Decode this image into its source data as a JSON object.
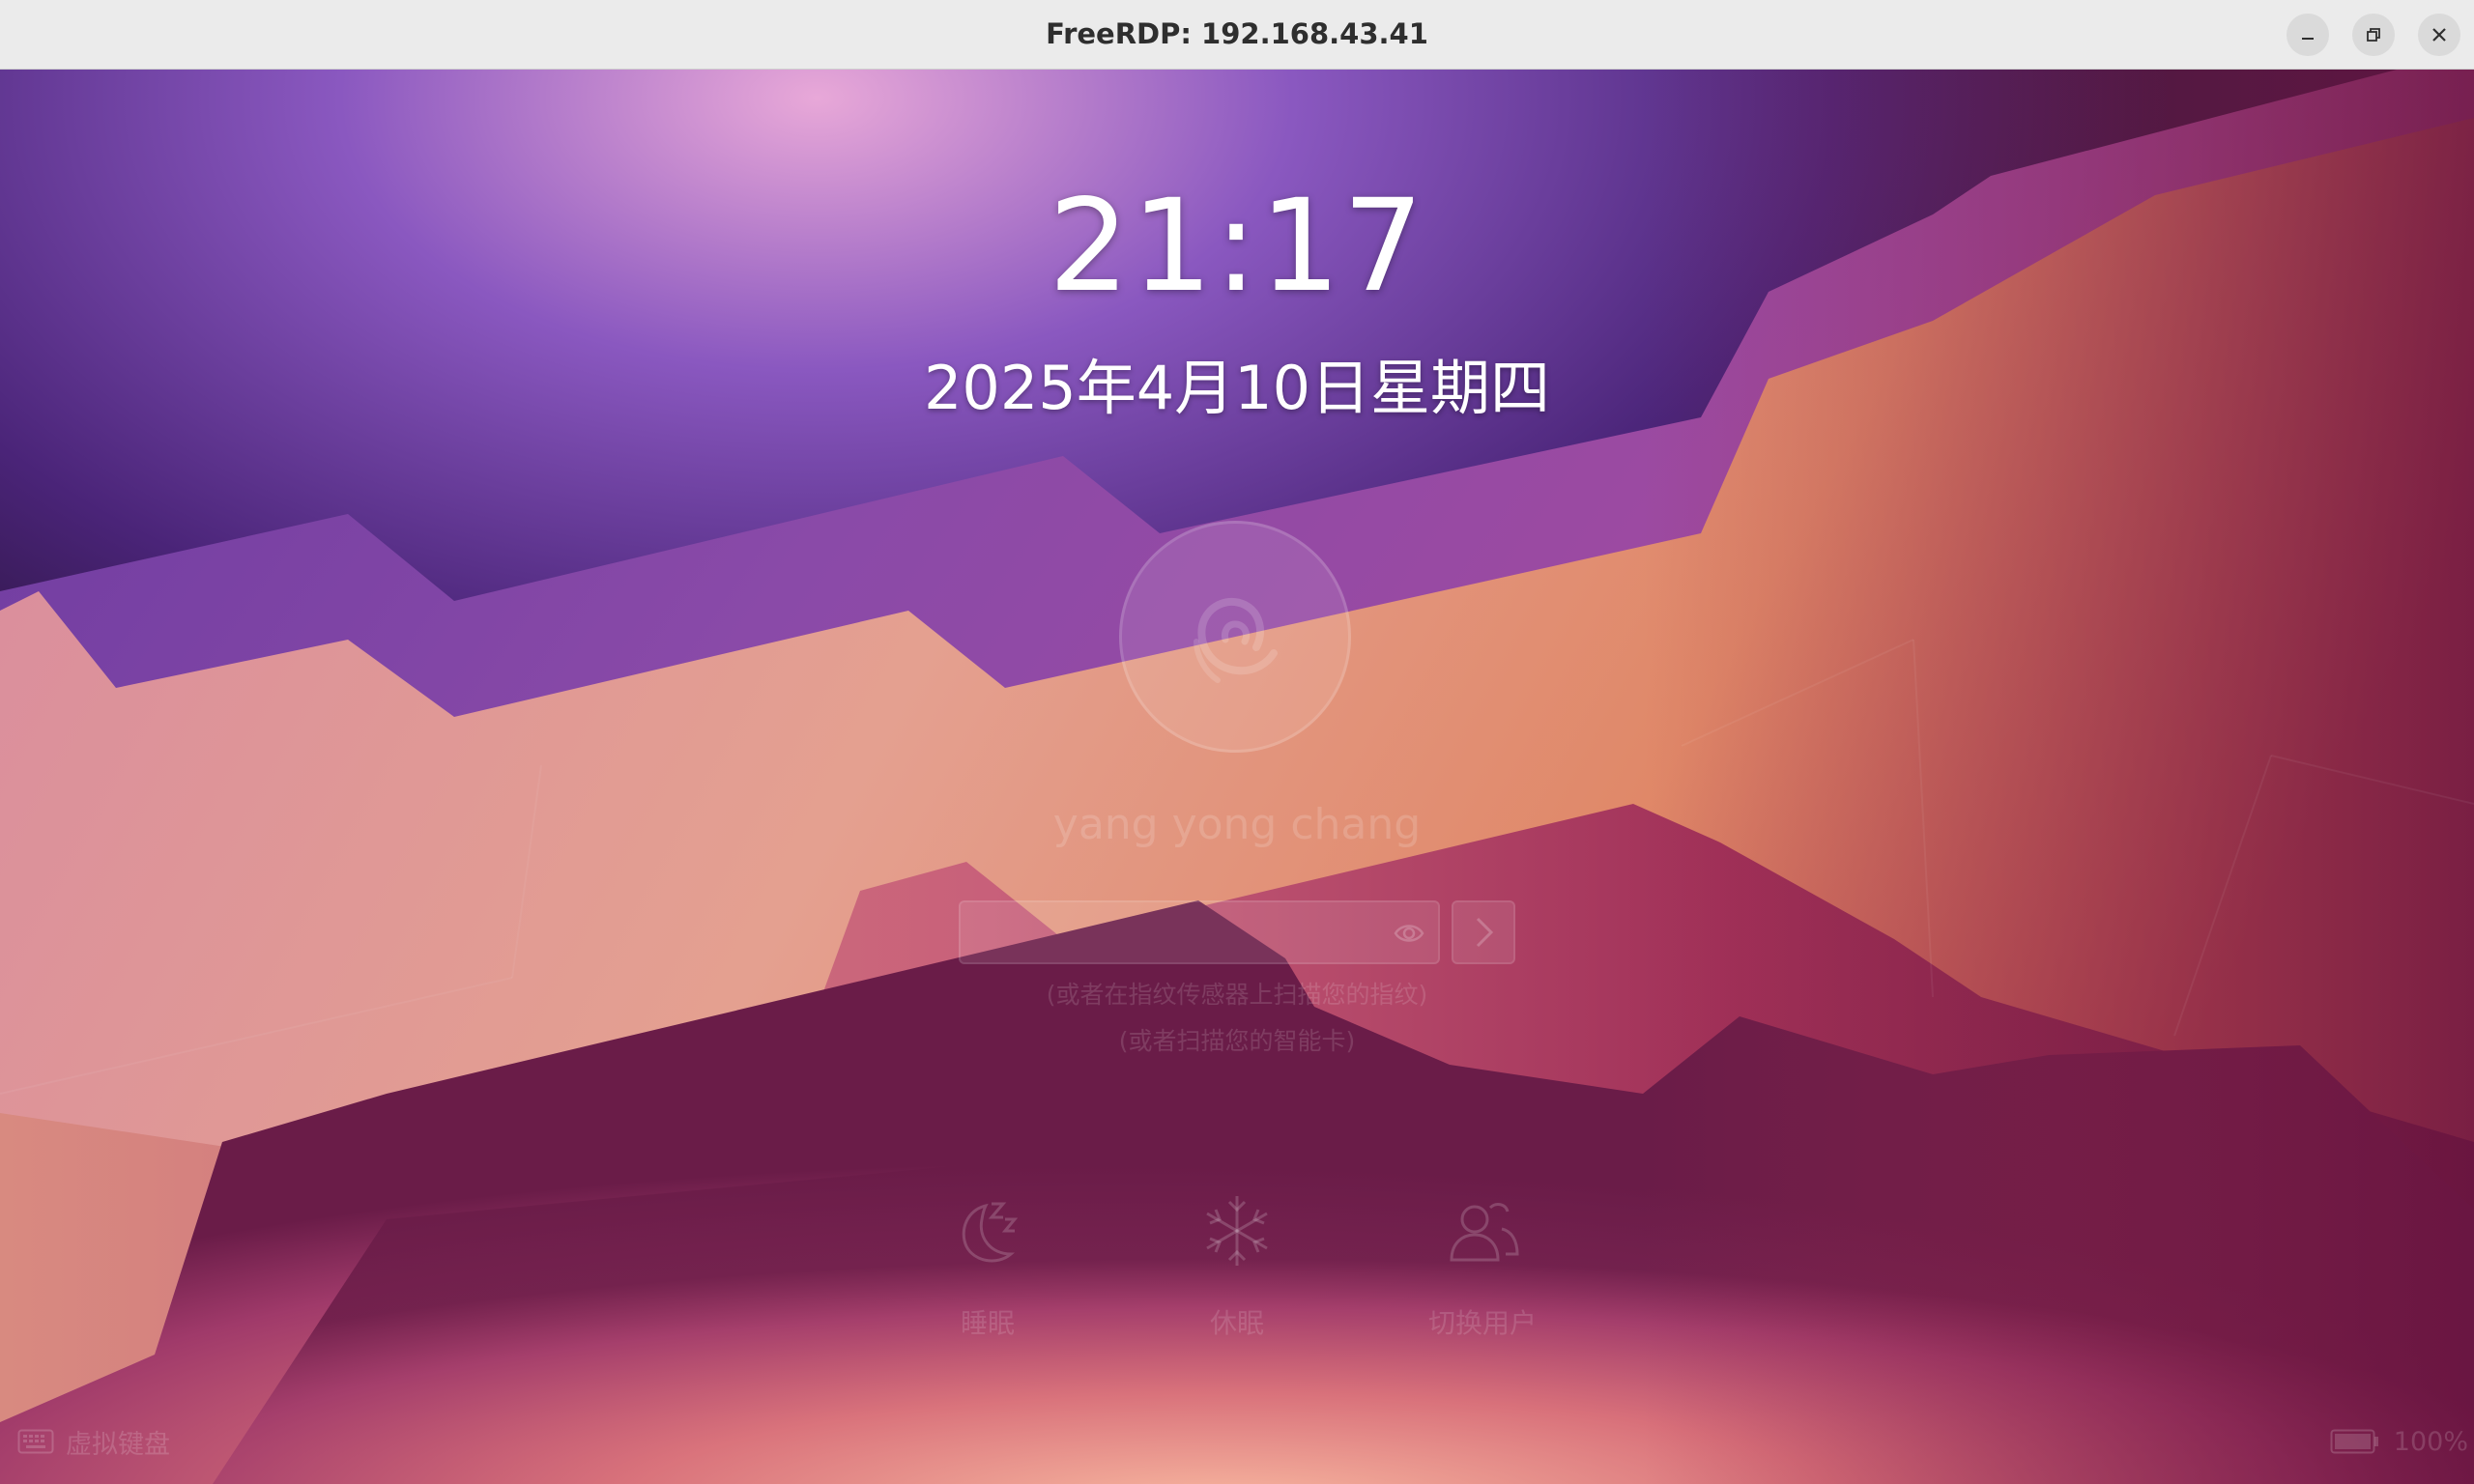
{
  "window": {
    "title": "FreeRDP: 192.168.43.41",
    "minimize_icon": "minimize-icon",
    "maximize_icon": "restore-icon",
    "close_icon": "close-icon"
  },
  "lockscreen": {
    "time": "21:17",
    "date": "2025年4月10日星期四",
    "avatar_icon": "debian-swirl-icon",
    "username": "yang yong chang",
    "password": {
      "value": "",
      "placeholder": "",
      "reveal_icon": "eye-icon",
      "submit_icon": "chevron-right-icon"
    },
    "hints": [
      "(或者在指纹传感器上扫描您的指纹)",
      "(或者扫描您的智能卡)"
    ],
    "actions": [
      {
        "label": "睡眠",
        "icon": "moon-zz-icon"
      },
      {
        "label": "休眠",
        "icon": "snowflake-icon"
      },
      {
        "label": "切换用户",
        "icon": "switch-user-icon"
      }
    ],
    "virtual_keyboard": {
      "label": "虚拟键盘",
      "icon": "keyboard-icon"
    },
    "battery": {
      "label": "100%",
      "icon": "battery-icon",
      "level": 1.0
    }
  },
  "colors": {
    "titlebar_bg": "#ebebeb",
    "wallpaper_purple": "#5a2a8a",
    "wallpaper_orange": "#e8906a",
    "wallpaper_magenta": "#9a2a5a"
  }
}
